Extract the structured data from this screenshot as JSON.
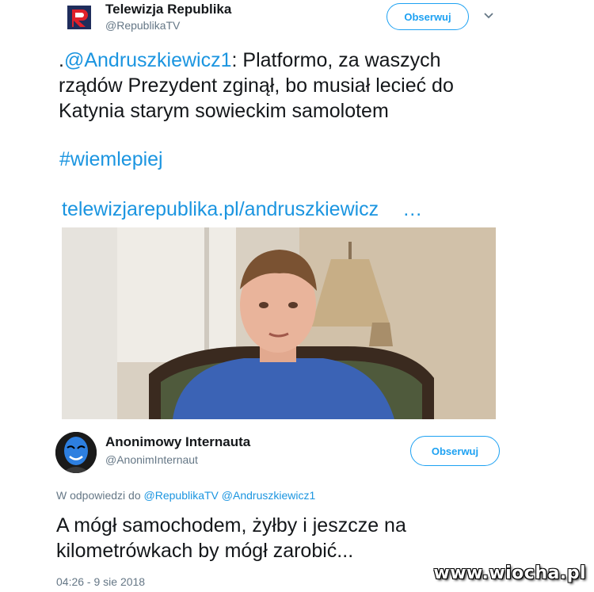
{
  "tweet": {
    "author_name": "Telewizja Republika",
    "author_handle": "@RepublikaTV",
    "follow_label": "Obserwuj",
    "text_prefix": ".",
    "mention": "@Andruszkiewicz1",
    "text_line1_rest": ": Platformo, za waszych",
    "text_line2": "rządów Prezydent zginął, bo musiał lecieć do",
    "text_line3": "Katynia starym sowieckim samolotem",
    "hashtag": "#wiemlepiej",
    "link": "telewizjarepublika.pl/andruszkiewicz",
    "link_ellipsis": "…"
  },
  "reply": {
    "author_name": "Anonimowy Internauta",
    "author_handle": "@AnonimInternaut",
    "follow_label": "Obserwuj",
    "in_reply_prefix": "W odpowiedzi do",
    "in_reply_to_1": "@RepublikaTV",
    "in_reply_to_2": "@Andruszkiewicz1",
    "text_line1": "A mógł samochodem, żyłby i jeszcze na",
    "text_line2": "kilometrówkach by mógł zarobić...",
    "timestamp": "04:26 - 9 sie 2018"
  },
  "watermark": "www.wiocha.pl",
  "colors": {
    "accent": "#1da1f2",
    "link": "#1b95e0",
    "text": "#14171a",
    "secondary": "#657786",
    "logo_red": "#e0202a",
    "logo_navy": "#1f2d5c"
  },
  "icons": {
    "logo": "republika-logo-icon",
    "caret": "chevron-down-icon",
    "avatar": "anonymous-mask-avatar"
  }
}
